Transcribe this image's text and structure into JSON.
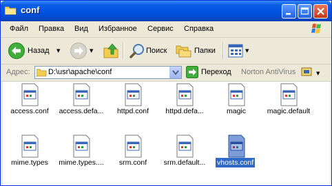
{
  "window": {
    "title": "conf"
  },
  "menu": [
    "Файл",
    "Правка",
    "Вид",
    "Избранное",
    "Сервис",
    "Справка"
  ],
  "toolbar": {
    "back_label": "Назад",
    "search_label": "Поиск",
    "folders_label": "Папки"
  },
  "address": {
    "label": "Адрес:",
    "value": "D:\\usr\\apache\\conf",
    "go_label": "Переход",
    "norton_label": "Norton AntiVirus"
  },
  "files": [
    {
      "name": "access.conf",
      "selected": false
    },
    {
      "name": "access.defa...",
      "selected": false
    },
    {
      "name": "httpd.conf",
      "selected": false
    },
    {
      "name": "httpd.defa...",
      "selected": false
    },
    {
      "name": "magic",
      "selected": false
    },
    {
      "name": "magic.default",
      "selected": false
    },
    {
      "name": "mime.types",
      "selected": false
    },
    {
      "name": "mime.types....",
      "selected": false
    },
    {
      "name": "srm.conf",
      "selected": false
    },
    {
      "name": "srm.default...",
      "selected": false
    },
    {
      "name": "vhosts.conf",
      "selected": true
    }
  ],
  "colors": {
    "titlebar": "#0054E3",
    "selection": "#316AC5",
    "chrome": "#ECE9D8"
  }
}
